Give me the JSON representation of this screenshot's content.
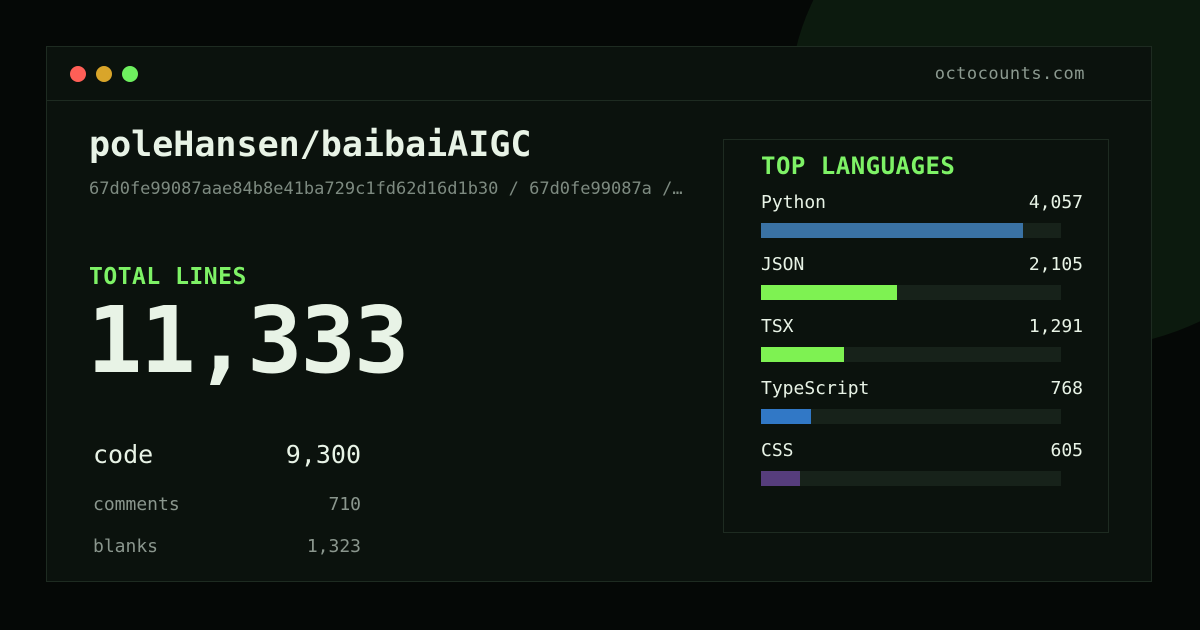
{
  "window": {
    "domain": "octocounts.com",
    "controls": {
      "close_color": "#ff5f57",
      "minimize_color": "#d9a52a",
      "maximize_color": "#6ef05f"
    }
  },
  "repo": {
    "name": "poleHansen/baibaiAIGC",
    "path": "67d0fe99087aae84b8e41ba729c1fd62d16d1b30 / 67d0fe99087a /…"
  },
  "totals": {
    "label": "TOTAL LINES",
    "value": "11,333"
  },
  "stats": [
    {
      "label": "code",
      "value": "9,300"
    },
    {
      "label": "comments",
      "value": "710"
    },
    {
      "label": "blanks",
      "value": "1,323"
    }
  ],
  "languages": {
    "title": "TOP LANGUAGES",
    "max": 4650,
    "items": [
      {
        "name": "Python",
        "count": "4,057",
        "value": 4057,
        "color": "#3a72a4"
      },
      {
        "name": "JSON",
        "count": "2,105",
        "value": 2105,
        "color": "#7ef252"
      },
      {
        "name": "TSX",
        "count": "1,291",
        "value": 1291,
        "color": "#7ef252"
      },
      {
        "name": "TypeScript",
        "count": "768",
        "value": 768,
        "color": "#3178c6"
      },
      {
        "name": "CSS",
        "count": "605",
        "value": 605,
        "color": "#563d7c"
      }
    ]
  },
  "colors": {
    "accent": "#7ef266",
    "text": "#e8f3e6",
    "muted": "#8a968d"
  }
}
